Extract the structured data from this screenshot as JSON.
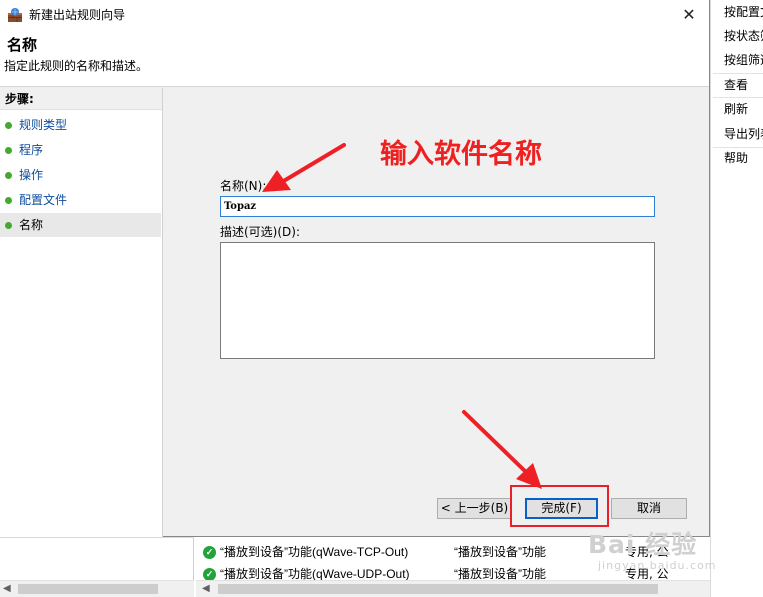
{
  "background_window": {
    "actions": [
      {
        "label": "按配置文件筛选"
      },
      {
        "label": "按状态筛选"
      },
      {
        "label": "按组筛选"
      },
      {
        "label": "查看"
      },
      {
        "label": "刷新"
      },
      {
        "label": "导出列表"
      },
      {
        "label": "帮助"
      }
    ],
    "rows": [
      {
        "name": "“播放到设备”功能(qWave-TCP-Out)",
        "group": "“播放到设备”功能",
        "profile": "专用, 公"
      },
      {
        "name": "“播放到设备”功能(qWave-UDP-Out)",
        "group": "“播放到设备”功能",
        "profile": "专用, 公"
      }
    ]
  },
  "dialog": {
    "title": "新建出站规则向导",
    "close_glyph": "✕",
    "header": {
      "title": "名称",
      "description": "指定此规则的名称和描述。"
    },
    "steps": {
      "title": "步骤:",
      "items": [
        {
          "label": "规则类型"
        },
        {
          "label": "程序"
        },
        {
          "label": "操作"
        },
        {
          "label": "配置文件"
        },
        {
          "label": "名称"
        }
      ]
    },
    "form": {
      "name_label": "名称(N):",
      "name_value": "Topaz",
      "description_label": "描述(可选)(D):",
      "description_value": ""
    },
    "buttons": {
      "back": "< 上一步(B)",
      "finish": "完成(F)",
      "cancel": "取消"
    }
  },
  "annotation": {
    "text": "输入软件名称",
    "color": "#f02020"
  },
  "watermark": {
    "main": "Bai 经验",
    "sub": "jingyan.baidu.com"
  },
  "colors": {
    "link": "#0f4c9c",
    "step_dot": "#43a92f",
    "focus_border": "#0a60c9",
    "check_green": "#22a33a"
  }
}
